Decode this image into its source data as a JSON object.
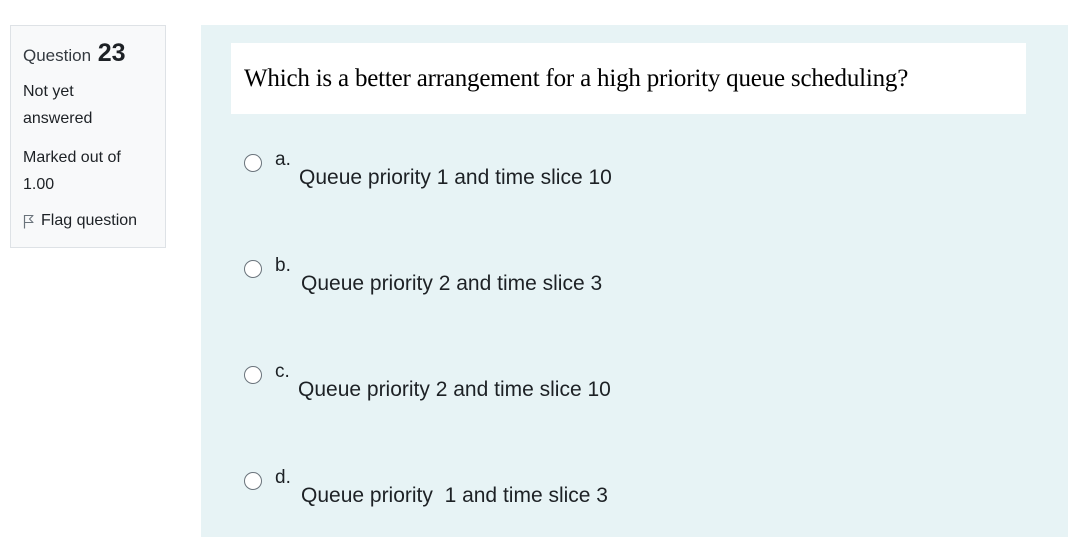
{
  "info": {
    "question_label": "Question",
    "question_number": "23",
    "state": "Not yet answered",
    "grade": "Marked out of 1.00",
    "flag_label": "Flag question"
  },
  "question": {
    "text": "Which is a better arrangement for a high priority queue scheduling?"
  },
  "answers": [
    {
      "letter": "a.",
      "text": "Queue priority 1 and time slice 10"
    },
    {
      "letter": "b.",
      "text": "Queue priority 2 and time slice 3"
    },
    {
      "letter": "c.",
      "text": "Queue priority 2 and time slice 10"
    },
    {
      "letter": "d.",
      "text": "Queue priority  1 and time slice 3"
    }
  ],
  "icons": {
    "flag": "flag-outline-icon",
    "radio": "radio-unchecked-icon"
  },
  "colors": {
    "info_bg": "#f8f9fa",
    "content_bg": "#e7f3f5",
    "text": "#1d2125"
  }
}
